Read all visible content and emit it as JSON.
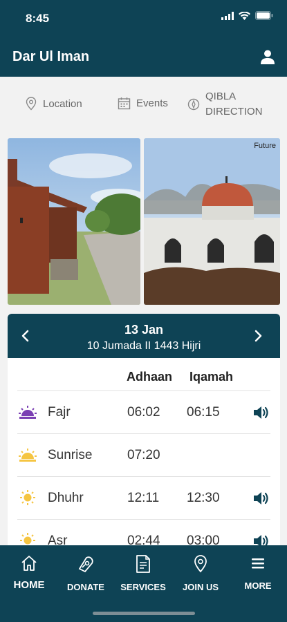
{
  "status": {
    "time": "8:45"
  },
  "header": {
    "title": "Dar Ul Iman"
  },
  "quicklinks": [
    {
      "label": "Location",
      "icon": "location-pin-icon"
    },
    {
      "label": "Events",
      "icon": "calendar-icon"
    },
    {
      "label": "QIBLA DIRECTION",
      "icon": "compass-icon"
    }
  ],
  "photos": {
    "right_caption": "Future"
  },
  "prayer": {
    "date": "13 Jan",
    "hijri": "10 Jumada II 1443 Hijri",
    "columns": {
      "adhaan": "Adhaan",
      "iqamah": "Iqamah"
    },
    "rows": [
      {
        "name": "Fajr",
        "adhaan": "06:02",
        "iqamah": "06:15"
      },
      {
        "name": "Sunrise",
        "adhaan": "07:20",
        "iqamah": ""
      },
      {
        "name": "Dhuhr",
        "adhaan": "12:11",
        "iqamah": "12:30"
      },
      {
        "name": "Asr",
        "adhaan": "02:44",
        "iqamah": "03:00"
      }
    ]
  },
  "nav": {
    "items": [
      {
        "label": "HOME",
        "icon": "home-icon"
      },
      {
        "label": "DONATE",
        "icon": "donate-icon"
      },
      {
        "label": "SERVICES",
        "icon": "document-icon"
      },
      {
        "label": "JOIN US",
        "icon": "location-pin-icon"
      },
      {
        "label": "MORE",
        "icon": "menu-icon"
      }
    ]
  },
  "colors": {
    "primary": "#0e4355",
    "fajr_icon": "#7b3fb3",
    "sun_icon": "#f5c542"
  }
}
